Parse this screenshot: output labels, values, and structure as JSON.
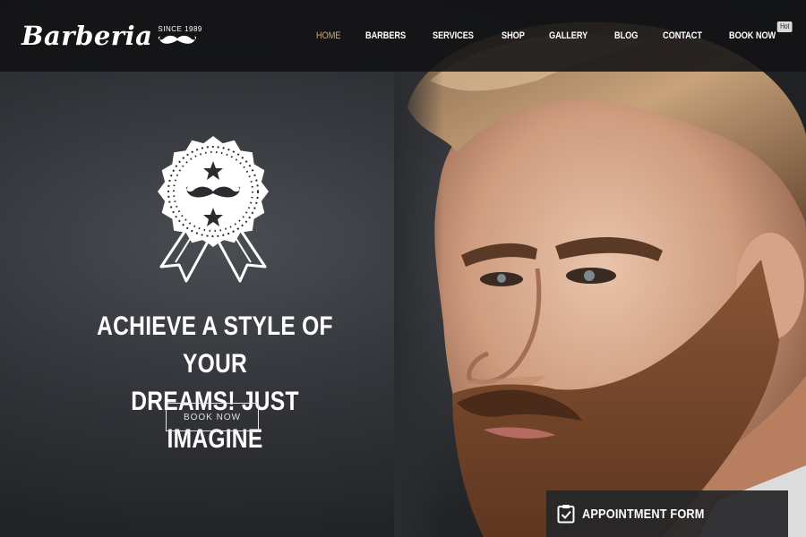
{
  "brand": {
    "name": "Barberia",
    "since": "SINCE 1989"
  },
  "nav": {
    "items": [
      {
        "label": "HOME",
        "active": true
      },
      {
        "label": "BARBERS",
        "active": false
      },
      {
        "label": "SERVICES",
        "active": false
      },
      {
        "label": "SHOP",
        "active": false
      },
      {
        "label": "GALLERY",
        "active": false
      },
      {
        "label": "BLOG",
        "active": false
      },
      {
        "label": "CONTACT",
        "active": false
      },
      {
        "label": "BOOK NOW",
        "active": false
      }
    ],
    "hot_badge": "Hot"
  },
  "hero": {
    "headline_line1": "ACHIEVE A STYLE OF YOUR",
    "headline_line2": "DREAMS! JUST IMAGINE",
    "button_label": "BOOK NOW",
    "badge_icon": "award-ribbon-mustache-icon"
  },
  "appointment": {
    "label": "APPOINTMENT FORM",
    "icon": "clipboard-check-icon"
  },
  "colors": {
    "accent": "#c7a97c",
    "header_bg": "#121214",
    "text": "#ffffff"
  }
}
